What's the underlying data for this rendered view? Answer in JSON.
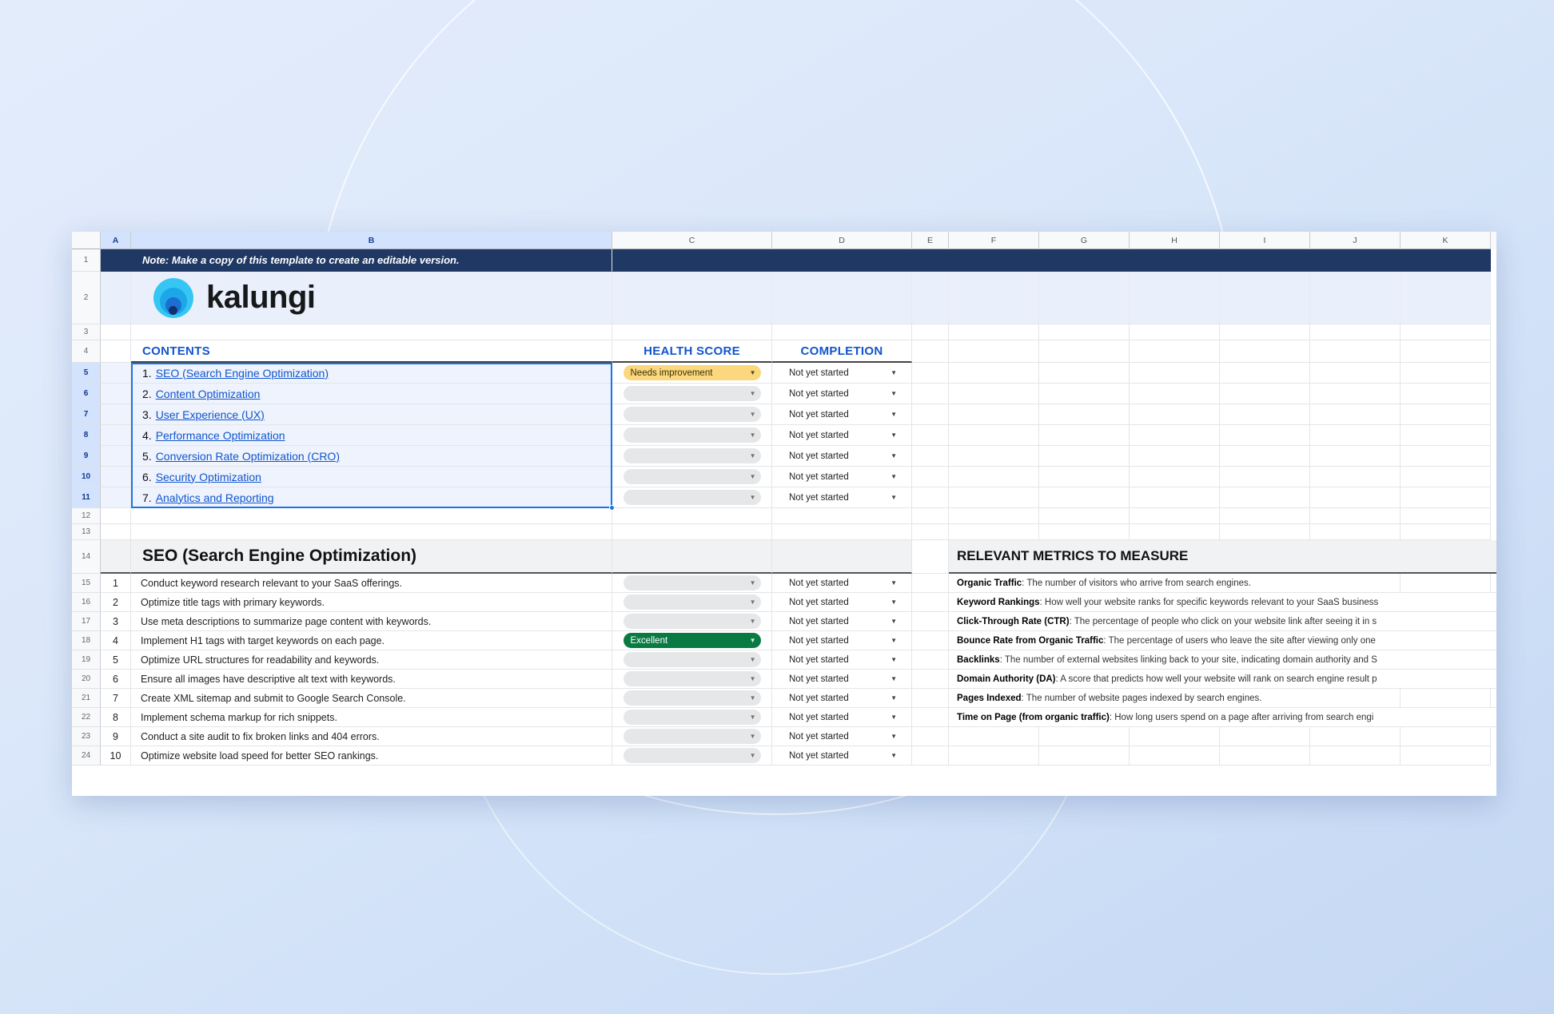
{
  "note_banner": "Note: Make a copy of this template to create an editable version.",
  "brand": {
    "name": "kalungi",
    "logo_icon": "kalungi-circles-logo"
  },
  "columns": [
    "A",
    "B",
    "C",
    "D",
    "E",
    "F",
    "G",
    "H",
    "I",
    "J",
    "K"
  ],
  "selected_column": "A",
  "row_numbers": [
    "1",
    "2",
    "3",
    "4",
    "5",
    "6",
    "7",
    "8",
    "9",
    "10",
    "11",
    "12",
    "13",
    "14",
    "15",
    "16",
    "17",
    "18",
    "19",
    "20",
    "21",
    "22",
    "23",
    "24"
  ],
  "selected_rows": [
    "5",
    "6",
    "7",
    "8",
    "9",
    "10",
    "11"
  ],
  "headers": {
    "contents": "CONTENTS",
    "health_score": "HEALTH SCORE",
    "completion": "COMPLETION"
  },
  "colors": {
    "link_blue": "#1155cc",
    "banner_navy": "#1f3864",
    "selection_blue": "#1a73e8",
    "chip_warn": "#fbd77d",
    "chip_good": "#0a7a43",
    "chip_blank": "#e6e7e9",
    "logo_cyan": "#35c6f4"
  },
  "contents": [
    {
      "num": "1.",
      "label": "SEO (Search Engine Optimization)",
      "health": "Needs improvement",
      "health_state": "warn",
      "completion": "Not yet started"
    },
    {
      "num": "2.",
      "label": "Content Optimization",
      "health": "",
      "health_state": "blank",
      "completion": "Not yet started"
    },
    {
      "num": "3.",
      "label": "User Experience (UX)",
      "health": "",
      "health_state": "blank",
      "completion": "Not yet started"
    },
    {
      "num": "4.",
      "label": "Performance Optimization",
      "health": "",
      "health_state": "blank",
      "completion": "Not yet started"
    },
    {
      "num": "5.",
      "label": "Conversion Rate Optimization (CRO)",
      "health": "",
      "health_state": "blank",
      "completion": "Not yet started"
    },
    {
      "num": "6.",
      "label": "Security Optimization",
      "health": "",
      "health_state": "blank",
      "completion": "Not yet started"
    },
    {
      "num": "7.",
      "label": "Analytics and Reporting",
      "health": "",
      "health_state": "blank",
      "completion": "Not yet started"
    }
  ],
  "section": {
    "title": "SEO (Search Engine Optimization)",
    "metrics_title": "RELEVANT METRICS TO MEASURE",
    "tasks": [
      {
        "num": "1",
        "text": "Conduct keyword research relevant to your SaaS offerings.",
        "health": "",
        "health_state": "blank",
        "completion": "Not yet started"
      },
      {
        "num": "2",
        "text": "Optimize title tags with primary keywords.",
        "health": "",
        "health_state": "blank",
        "completion": "Not yet started"
      },
      {
        "num": "3",
        "text": "Use meta descriptions to summarize page content with keywords.",
        "health": "",
        "health_state": "blank",
        "completion": "Not yet started"
      },
      {
        "num": "4",
        "text": "Implement H1 tags with target keywords on each page.",
        "health": "Excellent",
        "health_state": "good",
        "completion": "Not yet started"
      },
      {
        "num": "5",
        "text": "Optimize URL structures for readability and keywords.",
        "health": "",
        "health_state": "blank",
        "completion": "Not yet started"
      },
      {
        "num": "6",
        "text": "Ensure all images have descriptive alt text with keywords.",
        "health": "",
        "health_state": "blank",
        "completion": "Not yet started"
      },
      {
        "num": "7",
        "text": "Create XML sitemap and submit to Google Search Console.",
        "health": "",
        "health_state": "blank",
        "completion": "Not yet started"
      },
      {
        "num": "8",
        "text": "Implement schema markup for rich snippets.",
        "health": "",
        "health_state": "blank",
        "completion": "Not yet started"
      },
      {
        "num": "9",
        "text": "Conduct a site audit to fix broken links and 404 errors.",
        "health": "",
        "health_state": "blank",
        "completion": "Not yet started"
      },
      {
        "num": "10",
        "text": "Optimize website load speed for better SEO rankings.",
        "health": "",
        "health_state": "blank",
        "completion": "Not yet started"
      }
    ],
    "metrics": [
      {
        "name": "Organic Traffic",
        "desc": ": The number of visitors who arrive from search engines.",
        "wide": false
      },
      {
        "name": "Keyword Rankings",
        "desc": ": How well your website ranks for specific keywords relevant to your SaaS business",
        "wide": true
      },
      {
        "name": "Click-Through Rate (CTR)",
        "desc": ": The percentage of people who click on your website link after seeing it in s",
        "wide": true
      },
      {
        "name": "Bounce Rate from Organic Traffic",
        "desc": ": The percentage of users who leave the site after viewing only one",
        "wide": true
      },
      {
        "name": "Backlinks",
        "desc": ": The number of external websites linking back to your site, indicating domain authority and S",
        "wide": true
      },
      {
        "name": "Domain Authority (DA)",
        "desc": ": A score that predicts how well your website will rank on search engine result p",
        "wide": true
      },
      {
        "name": "Pages Indexed",
        "desc": ": The number of website pages indexed by search engines.",
        "wide": false
      },
      {
        "name": "Time on Page (from organic traffic)",
        "desc": ": How long users spend on a page after arriving from search engi",
        "wide": true
      }
    ]
  }
}
